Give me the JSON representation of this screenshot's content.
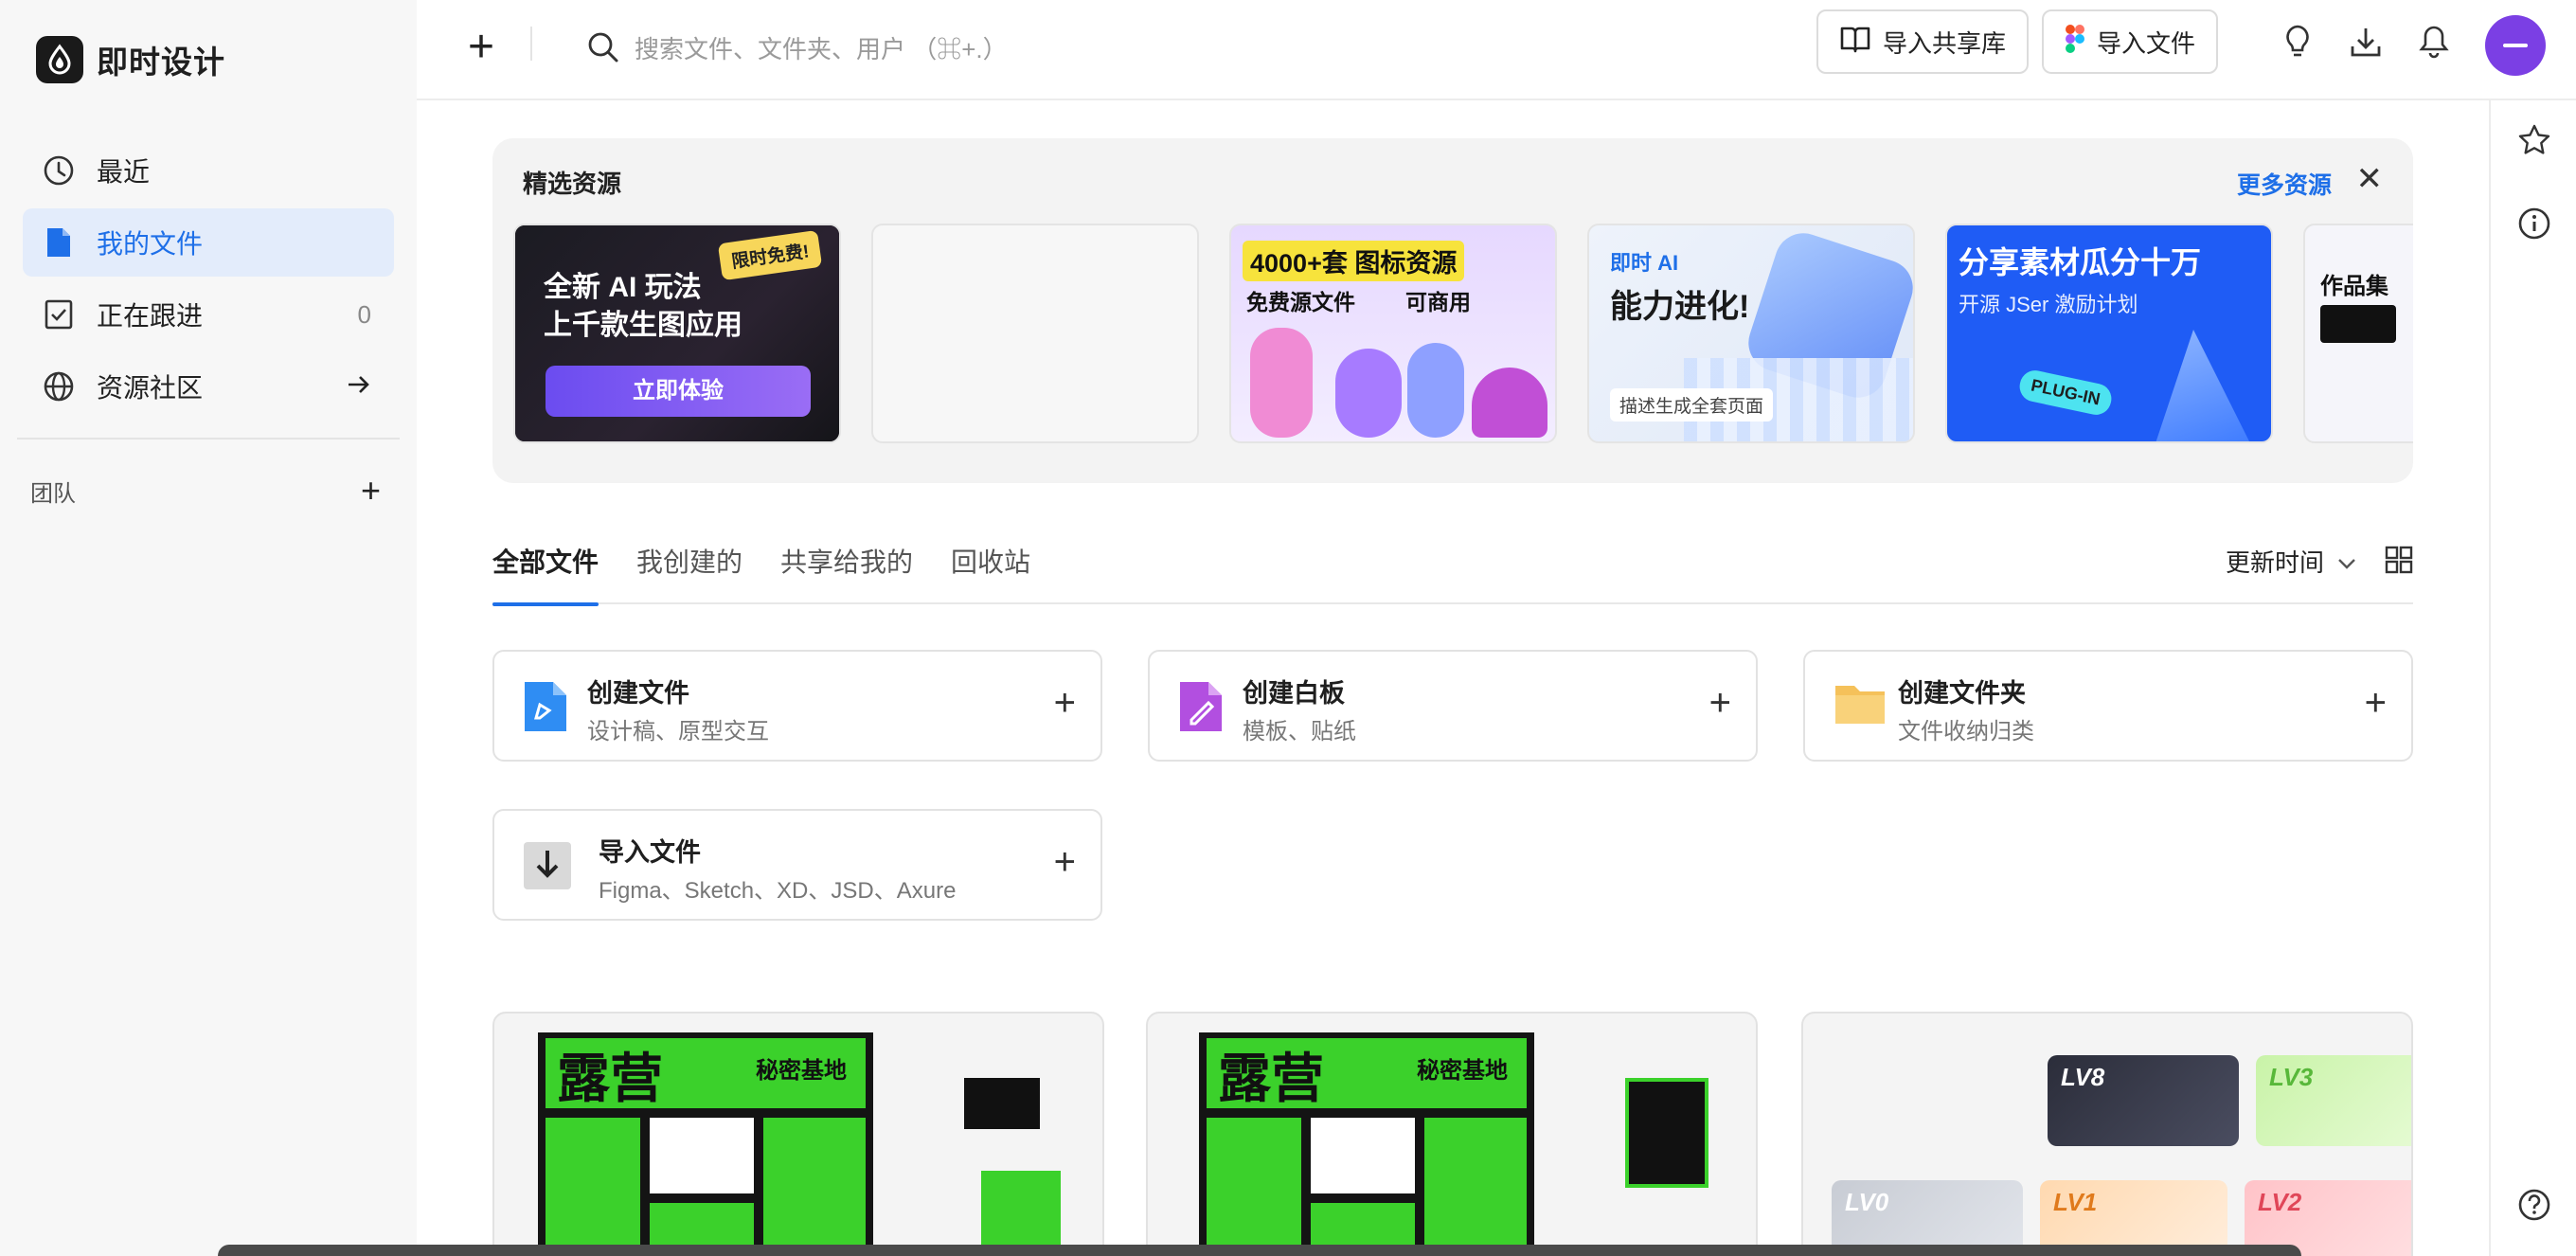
{
  "app": {
    "name": "即时设计"
  },
  "sidebar": {
    "items": [
      {
        "label": "最近",
        "icon": "clock-icon"
      },
      {
        "label": "我的文件",
        "icon": "file-icon",
        "active": true
      },
      {
        "label": "正在跟进",
        "icon": "follow-icon",
        "count": "0"
      },
      {
        "label": "资源社区",
        "icon": "globe-icon"
      }
    ],
    "team_label": "团队"
  },
  "topbar": {
    "search_placeholder": "搜索文件、文件夹、用户 （⌘+.）",
    "import_library": "导入共享库",
    "import_file": "导入文件"
  },
  "featured": {
    "title": "精选资源",
    "more": "更多资源",
    "cards": [
      {
        "line1": "全新 AI 玩法",
        "line2": "上千款生图应用",
        "badge": "限时免费!",
        "cta": "立即体验"
      },
      {},
      {
        "line1": "4000+套 图标资源",
        "line2": "免费源文件",
        "line3": "可商用"
      },
      {
        "tag": "即时 AI",
        "line1": "能力进化!",
        "line2": "描述生成全套页面"
      },
      {
        "line1": "分享素材瓜分十万",
        "line2": "开源 JSer 激励计划",
        "badge": "PLUG-IN"
      },
      {
        "line1": "作品集"
      }
    ]
  },
  "tabs": {
    "items": [
      "全部文件",
      "我创建的",
      "共享给我的",
      "回收站"
    ],
    "sort_label": "更新时间"
  },
  "create": [
    {
      "title": "创建文件",
      "sub": "设计稿、原型交互",
      "icon": "design-file-icon"
    },
    {
      "title": "创建白板",
      "sub": "模板、贴纸",
      "icon": "whiteboard-icon"
    },
    {
      "title": "创建文件夹",
      "sub": "文件收纳归类",
      "icon": "folder-icon"
    },
    {
      "title": "导入文件",
      "sub": "Figma、Sketch、XD、JSD、Axure",
      "icon": "import-icon"
    }
  ],
  "files": {
    "poster_title": "露营",
    "poster_sub": "秘密基地",
    "levels": [
      "LV8",
      "LV3",
      "LV0",
      "LV1",
      "LV2"
    ]
  },
  "colors": {
    "accent": "#1e6fe8",
    "avatar": "#7b3fe4",
    "active_bg": "#e3ecfb"
  }
}
